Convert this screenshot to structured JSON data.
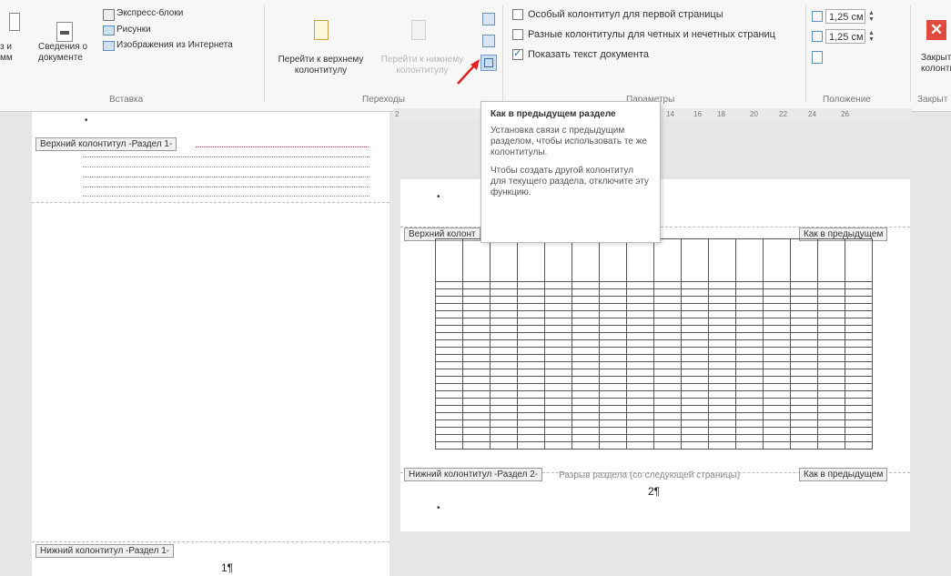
{
  "ribbon": {
    "insert": {
      "cut_label_1": "з и",
      "cut_label_2": "мм",
      "doc_info_label_1": "Сведения о",
      "doc_info_label_2": "документе",
      "quick_parts": "Экспресс-блоки",
      "pictures": "Рисунки",
      "online_pictures": "Изображения из Интернета",
      "group_label": "Вставка"
    },
    "navigation": {
      "goto_header_1": "Перейти к верхнему",
      "goto_header_2": "колонтитулу",
      "goto_footer_1": "Перейти к нижнему",
      "goto_footer_2": "колонтитулу",
      "group_label": "Переходы"
    },
    "options": {
      "diff_first": "Особый колонтитул для первой страницы",
      "diff_odd_even": "Разные колонтитулы для четных и нечетных страниц",
      "show_text": "Показать текст документа",
      "group_label": "Параметры"
    },
    "position": {
      "header_from_top": "1,25 см",
      "footer_from_bottom": "1,25 см",
      "group_label": "Положение"
    },
    "close": {
      "label_1": "Закрыть о",
      "label_2": "колонтиту",
      "group_label": "Закрыт"
    }
  },
  "tooltip": {
    "title": "Как в предыдущем разделе",
    "para1": "Установка связи с предыдущим разделом, чтобы использовать те же колонтитулы.",
    "para2": "Чтобы создать другой колонтитул для текущего раздела, отключите эту функцию."
  },
  "ruler": [
    "2",
    "14",
    "16",
    "18",
    "20",
    "22",
    "24",
    "26"
  ],
  "page1": {
    "header_tag": "Верхний колонтитул -Раздел 1-",
    "footer_tag": "Нижний колонтитул -Раздел 1-",
    "page_num": "1¶"
  },
  "page2": {
    "header_tag": "Верхний колонт",
    "same_as_prev_top": "Как в предыдущем",
    "footer_tag": "Нижний колонтитул -Раздел 2-",
    "section_break": "Разрыв раздела (со следующей страницы)",
    "same_as_prev_bottom": "Как в предыдущем",
    "page_num": "2¶"
  },
  "icons": {
    "close": "close-x-icon",
    "link_previous": "link-to-previous-icon"
  },
  "colors": {
    "close_red": "#e04a3f",
    "arrow_red": "#e02020"
  }
}
